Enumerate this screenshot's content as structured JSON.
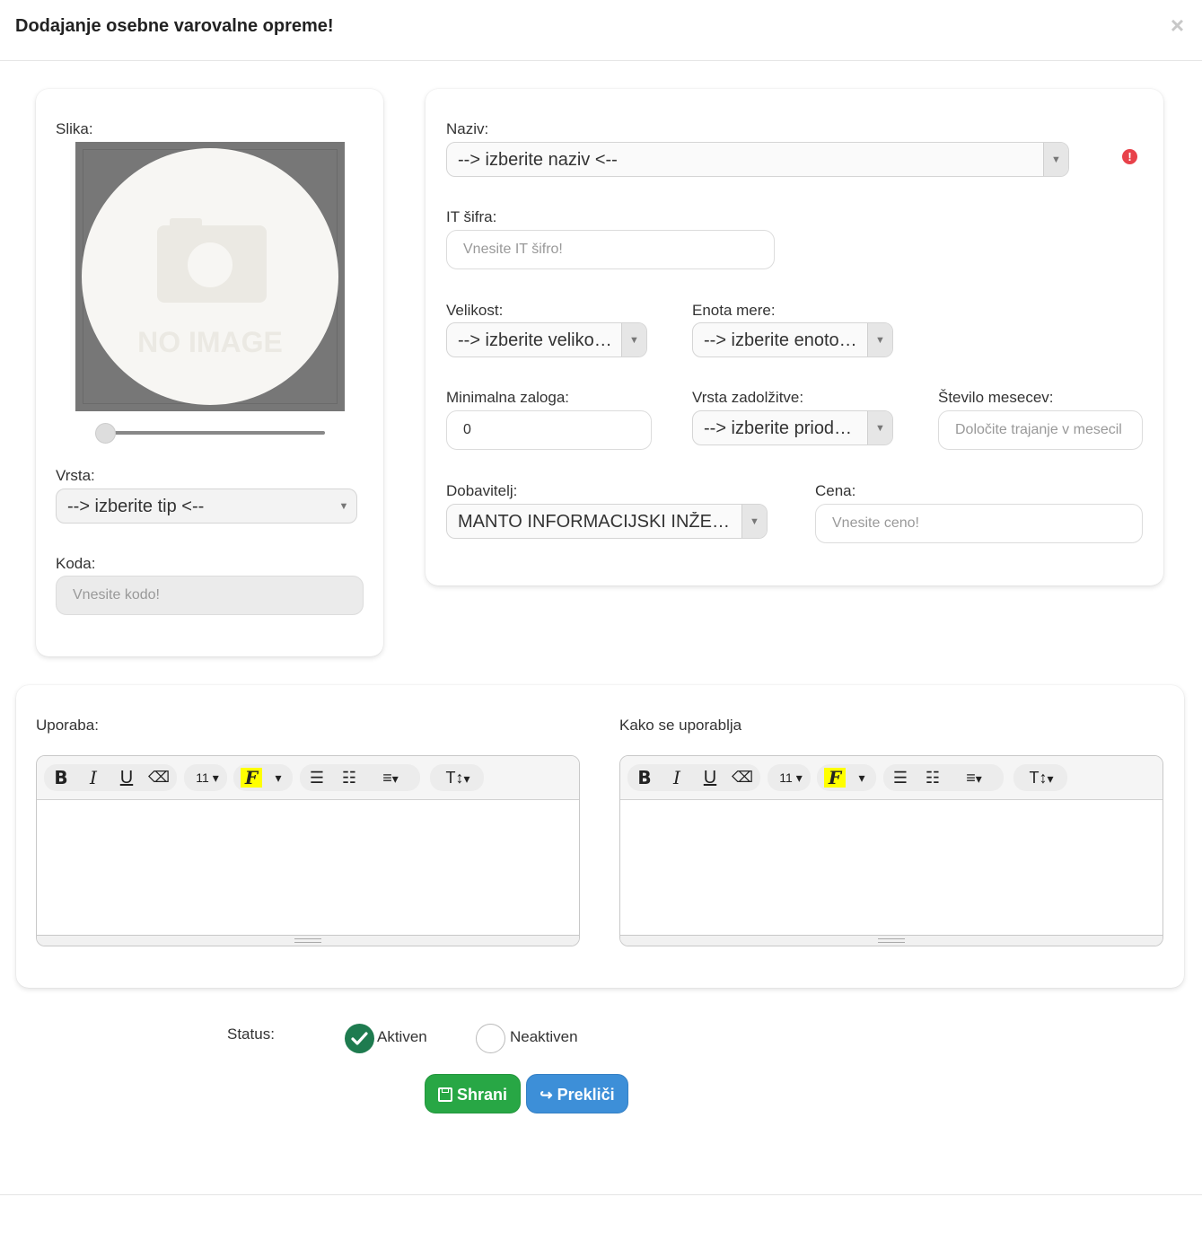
{
  "modal": {
    "title": "Dodajanje osebne varovalne opreme!",
    "close": "×"
  },
  "left": {
    "image_label": "Slika:",
    "no_image": "NO IMAGE",
    "zoom_value": 0,
    "type_label": "Vrsta:",
    "type_value": "--> izberite tip <--",
    "code_label": "Koda:",
    "code_placeholder": "Vnesite kodo!"
  },
  "right": {
    "name_label": "Naziv:",
    "name_value": "--> izberite naziv <--",
    "name_error_icon": "!",
    "it_label": "IT šifra:",
    "it_placeholder": "Vnesite IT šifro!",
    "size_label": "Velikost:",
    "size_value": "--> izberite veliko…",
    "unit_label": "Enota mere:",
    "unit_value": "--> izberite enoto…",
    "minstock_label": "Minimalna zaloga:",
    "minstock_value": "0",
    "charge_label": "Vrsta zadolžitve:",
    "charge_value": "--> izberite priod…",
    "months_label": "Število mesecev:",
    "months_placeholder": "Določite trajanje v mesecil",
    "supplier_label": "Dobavitelj:",
    "supplier_value": "MANTO INFORMACIJSKI INŽE…",
    "price_label": "Cena:",
    "price_placeholder": "Vnesite ceno!"
  },
  "editors": {
    "usage_label": "Uporaba:",
    "howto_label": "Kako se uporablja",
    "toolbar": {
      "bold": "B",
      "italic": "I",
      "underline": "U",
      "eraser": "⌫",
      "font_size": "11",
      "font_icon": "F",
      "ul": "☰",
      "ol": "☷",
      "align": "≡",
      "text_height": "T↕",
      "caret": "▾"
    }
  },
  "status": {
    "label": "Status:",
    "active": "Aktiven",
    "inactive": "Neaktiven",
    "selected": "Aktiven"
  },
  "buttons": {
    "save": "Shrani",
    "cancel": "Prekliči"
  },
  "colors": {
    "save": "#28a745",
    "cancel": "#3d8fd8",
    "radio_checked": "#1e7b4f",
    "error": "#e8424a"
  }
}
